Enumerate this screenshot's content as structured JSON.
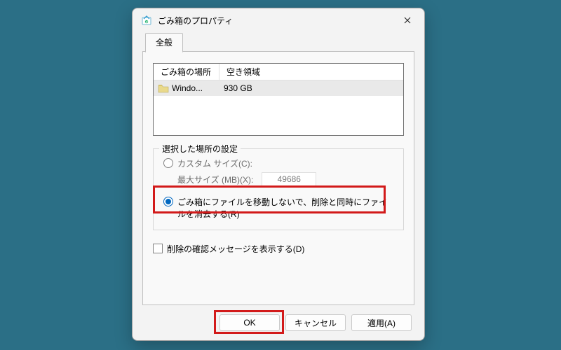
{
  "title": "ごみ箱のプロパティ",
  "tabs": {
    "general": "全般"
  },
  "grid": {
    "headers": {
      "location": "ごみ箱の場所",
      "free": "空き領域"
    },
    "row": {
      "name": "Windo...",
      "free": "930 GB"
    }
  },
  "group": {
    "title": "選択した場所の設定",
    "radio_custom": "カスタム サイズ(C):",
    "max_size_label": "最大サイズ (MB)(X):",
    "max_size_value": "49686",
    "radio_delete": "ごみ箱にファイルを移動しないで、削除と同時にファイルを消去する(R)"
  },
  "confirm_checkbox": "削除の確認メッセージを表示する(D)",
  "buttons": {
    "ok": "OK",
    "cancel": "キャンセル",
    "apply": "適用(A)"
  }
}
